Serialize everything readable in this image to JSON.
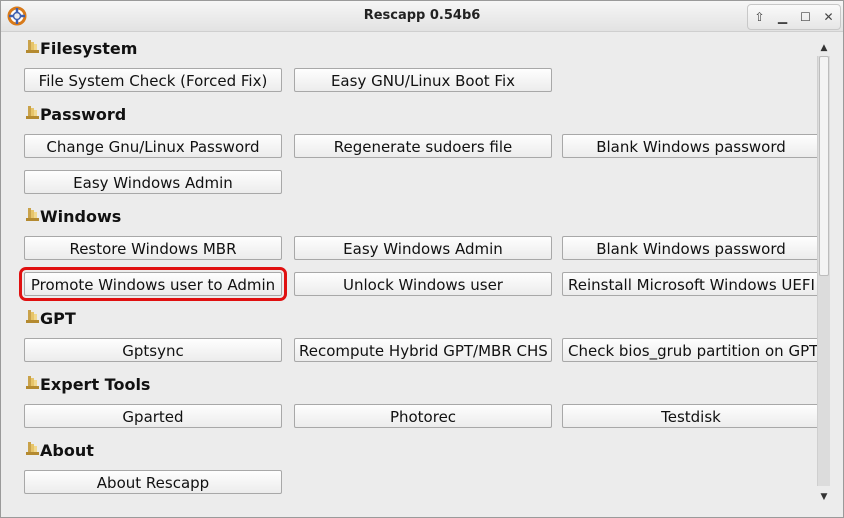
{
  "window": {
    "title": "Rescapp 0.54b6",
    "controls": {
      "up": "⇧",
      "minimize": "▁",
      "maximize": "☐",
      "close": "✕"
    }
  },
  "sections": {
    "filesystem": {
      "title": "Filesystem",
      "buttons": [
        "File System Check (Forced Fix)",
        "Easy GNU/Linux Boot Fix"
      ]
    },
    "password": {
      "title": "Password",
      "buttons": [
        "Change Gnu/Linux Password",
        "Regenerate sudoers file",
        "Blank Windows password",
        "Easy Windows Admin"
      ]
    },
    "windows": {
      "title": "Windows",
      "buttons": [
        "Restore Windows MBR",
        "Easy Windows Admin",
        "Blank Windows password",
        "Promote Windows user to Admin",
        "Unlock Windows user",
        "Reinstall Microsoft Windows UEFI"
      ]
    },
    "gpt": {
      "title": "GPT",
      "buttons": [
        "Gptsync",
        "Recompute Hybrid GPT/MBR CHS",
        "Check bios_grub partition on GPT"
      ]
    },
    "expert": {
      "title": "Expert Tools",
      "buttons": [
        "Gparted",
        "Photorec",
        "Testdisk"
      ]
    },
    "about": {
      "title": "About",
      "buttons": [
        "About Rescapp"
      ]
    }
  },
  "colors": {
    "highlight": "#e01010",
    "background": "#ececec"
  },
  "icons": {
    "section": "folder-icon",
    "app": "lifebuoy-icon"
  }
}
